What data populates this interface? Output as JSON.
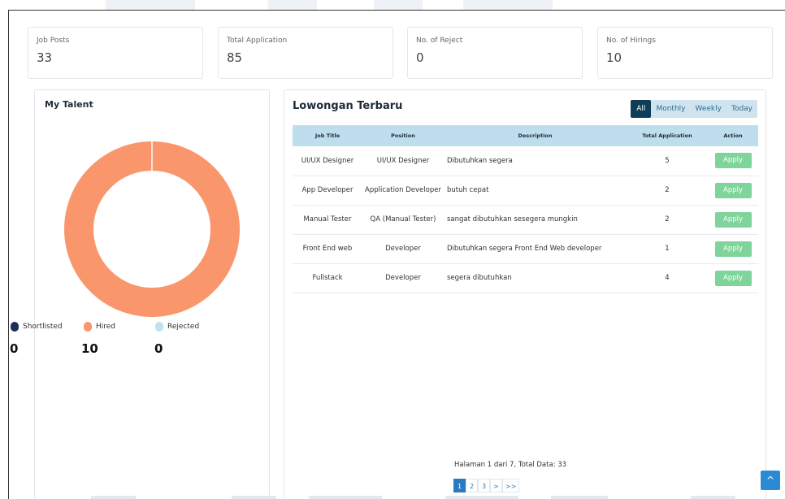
{
  "stats": [
    {
      "label": "Job Posts",
      "value": "33"
    },
    {
      "label": "Total Application",
      "value": "85"
    },
    {
      "label": "No. of Reject",
      "value": "0"
    },
    {
      "label": "No. of Hirings",
      "value": "10"
    }
  ],
  "talent": {
    "title": "My Talent",
    "legend": [
      {
        "label": "Shortlisted",
        "value": "0",
        "color": "#1e2d59"
      },
      {
        "label": "Hired",
        "value": "10",
        "color": "#f9966b"
      },
      {
        "label": "Rejected",
        "value": "0",
        "color": "#bfe3ea"
      }
    ],
    "chart_data": {
      "type": "pie",
      "categories": [
        "Shortlisted",
        "Hired",
        "Rejected"
      ],
      "values": [
        0,
        10,
        0
      ]
    }
  },
  "jobs": {
    "title": "Lowongan Terbaru",
    "filters": [
      "All",
      "Monthly",
      "Weekly",
      "Today"
    ],
    "active_filter": "All",
    "columns": [
      "Job Title",
      "Position",
      "Description",
      "Total Application",
      "Action"
    ],
    "rows": [
      {
        "title": "UI/UX Designer",
        "position": "UI/UX Designer",
        "description": "Dibutuhkan segera",
        "total": "5",
        "action": "Apply"
      },
      {
        "title": "App Developer",
        "position": "Application Developer",
        "description": "butuh cepat",
        "total": "2",
        "action": "Apply"
      },
      {
        "title": "Manual Tester",
        "position": "QA (Manual Tester)",
        "description": "sangat dibutuhkan sesegera mungkin",
        "total": "2",
        "action": "Apply"
      },
      {
        "title": "Front End web",
        "position": "Developer",
        "description": "Dibutuhkan segera Front End Web developer",
        "total": "1",
        "action": "Apply"
      },
      {
        "title": "Fullstack",
        "position": "Developer",
        "description": "segera dibutuhkan",
        "total": "4",
        "action": "Apply"
      }
    ],
    "page_info": "Halaman 1 dari 7, Total Data: 33",
    "pager": [
      "1",
      "2",
      "3",
      ">",
      ">>"
    ],
    "current_page": "1"
  },
  "scroll_top_icon": "chevron-up-icon"
}
